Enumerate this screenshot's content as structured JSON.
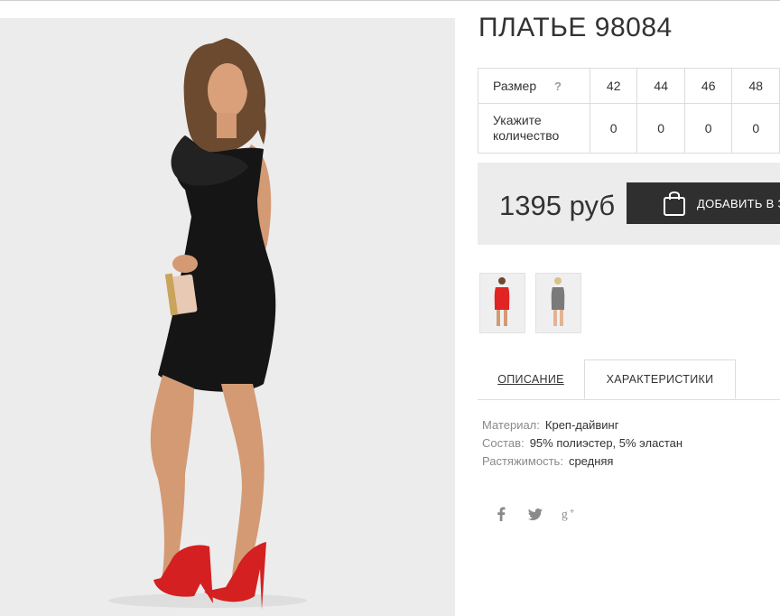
{
  "product": {
    "title": "ПЛАТЬЕ 98084",
    "price": "1395 руб",
    "add_to_cart_label": "ДОБАВИТЬ В З"
  },
  "size_table": {
    "size_label": "Размер",
    "help_mark": "?",
    "sizes": [
      "42",
      "44",
      "46",
      "48"
    ],
    "quantity_label": "Укажите количество",
    "quantities": [
      "0",
      "0",
      "0",
      "0"
    ]
  },
  "tabs": {
    "description": "ОПИСАНИЕ",
    "characteristics": "ХАРАКТЕРИСТИКИ",
    "active": "characteristics"
  },
  "specs": [
    {
      "key": "Материал:",
      "value": "Креп-дайвинг"
    },
    {
      "key": "Состав:",
      "value": "95% полиэстер, 5% эластан"
    },
    {
      "key": "Растяжимость:",
      "value": "средняя"
    }
  ],
  "social": [
    "facebook-icon",
    "twitter-icon",
    "google-plus-icon"
  ],
  "thumbnails": [
    "red-dress-thumbnail",
    "grey-dress-thumbnail"
  ],
  "colors": {
    "accent_dark": "#2f2f2f",
    "panel_bg": "#ececec",
    "border": "#dcdcdc",
    "dress_red": "#e02424"
  }
}
